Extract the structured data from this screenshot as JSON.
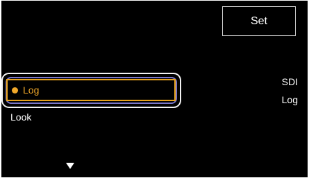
{
  "header": {
    "set_label": "Set"
  },
  "menu": {
    "items": [
      {
        "label": "Log",
        "selected": true
      },
      {
        "label": "Look",
        "selected": false
      }
    ],
    "scroll_indicator": "down-arrow-icon"
  },
  "status": {
    "output": "SDI",
    "mode": "Log"
  },
  "colors": {
    "background": "#000000",
    "selection_accent": "#f0a82a",
    "focus_ring": "#7a76c7",
    "text": "#ffffff"
  }
}
